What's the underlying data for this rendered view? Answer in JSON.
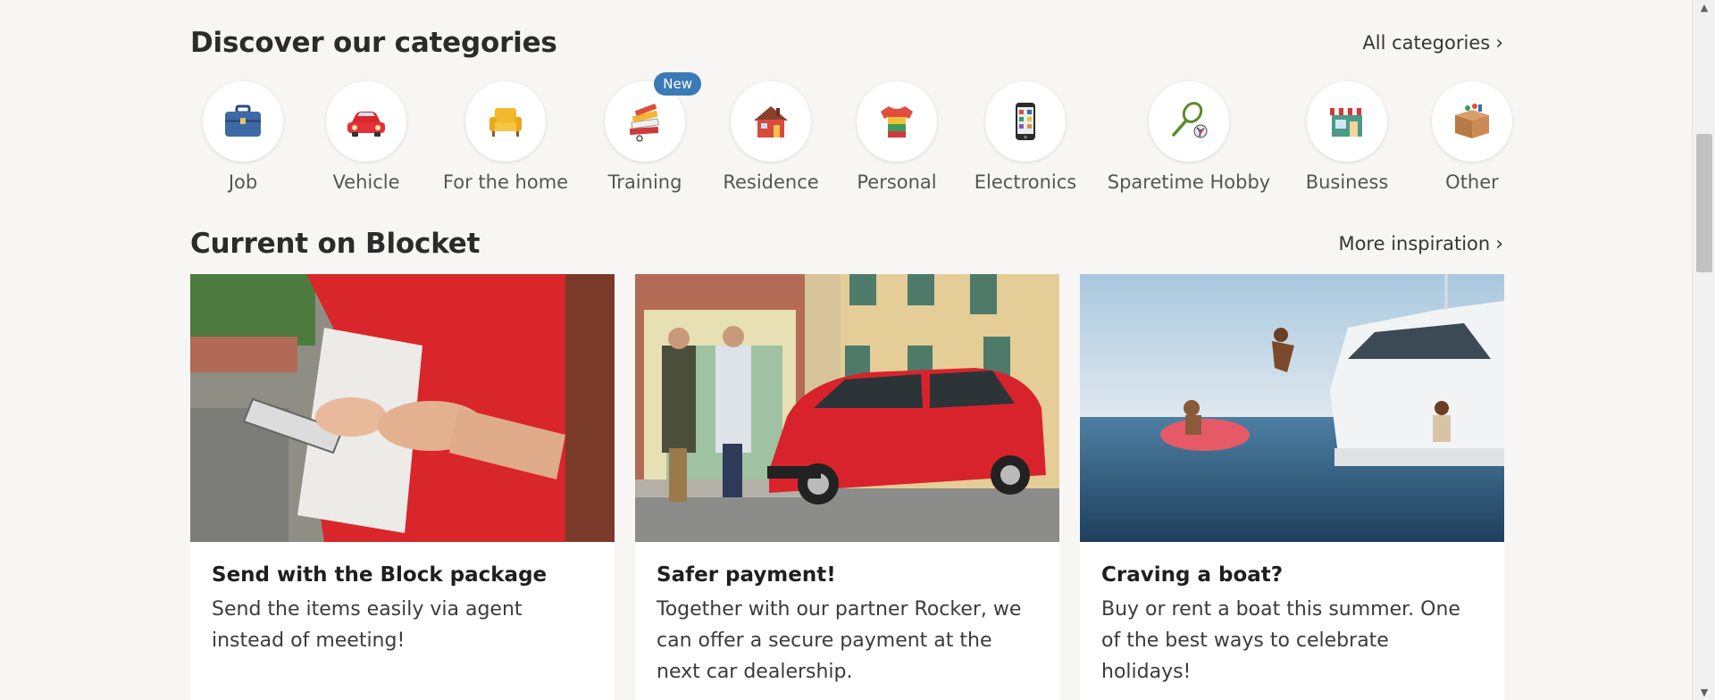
{
  "categories_section": {
    "title": "Discover our categories",
    "link_label": "All categories",
    "link_chevron": "›",
    "items": [
      {
        "label": "Job",
        "icon": "briefcase-icon"
      },
      {
        "label": "Vehicle",
        "icon": "car-icon"
      },
      {
        "label": "For the home",
        "icon": "armchair-icon"
      },
      {
        "label": "Training",
        "icon": "books-icon",
        "badge": "New"
      },
      {
        "label": "Residence",
        "icon": "house-icon"
      },
      {
        "label": "Personal",
        "icon": "tshirt-icon"
      },
      {
        "label": "Electronics",
        "icon": "smartphone-icon"
      },
      {
        "label": "Sparetime Hobby",
        "icon": "racket-ball-icon"
      },
      {
        "label": "Business",
        "icon": "shop-icon"
      },
      {
        "label": "Other",
        "icon": "box-icon"
      }
    ]
  },
  "current_section": {
    "title": "Current on Blocket",
    "link_label": "More inspiration",
    "link_chevron": "›",
    "cards": [
      {
        "title": "Send with the Block package",
        "text": "Send the items easily via agent instead of meeting!",
        "image": "courier-with-package-photo"
      },
      {
        "title": "Safer payment!",
        "text": "Together with our partner Rocker, we can offer a secure payment at the next car dealership.",
        "image": "red-car-and-two-men-photo"
      },
      {
        "title": "Craving a boat?",
        "text": "Buy or rent a boat this summer. One of the best ways to celebrate holidays!",
        "image": "people-swimming-by-boat-photo"
      }
    ]
  },
  "colors": {
    "background": "#f7f6f5",
    "badge": "#3a7ab7",
    "card": "#ffffff"
  }
}
